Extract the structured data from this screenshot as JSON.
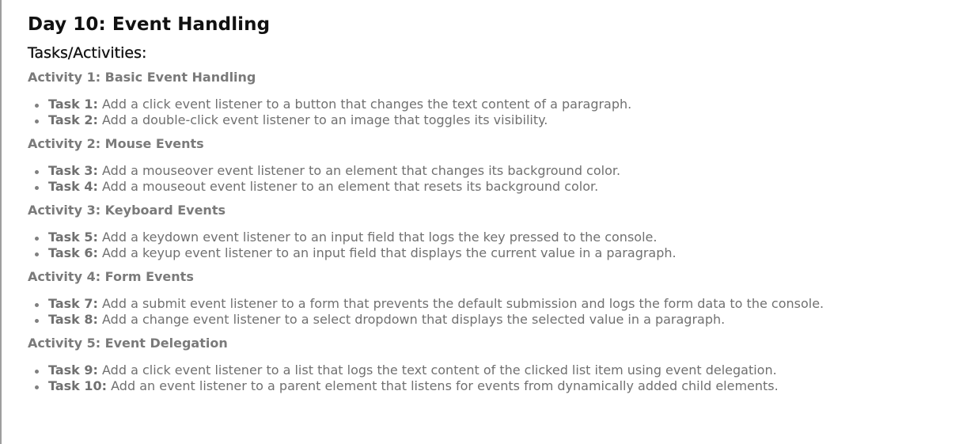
{
  "title": "Day 10: Event Handling",
  "subtitle": "Tasks/Activities:",
  "activities": [
    {
      "heading": "Activity 1: Basic Event Handling",
      "tasks": [
        {
          "label": "Task 1:",
          "text": " Add a click event listener to a button that changes the text content of a paragraph."
        },
        {
          "label": "Task 2:",
          "text": " Add a double-click event listener to an image that toggles its visibility."
        }
      ]
    },
    {
      "heading": "Activity 2: Mouse Events",
      "tasks": [
        {
          "label": "Task 3:",
          "text": " Add a mouseover event listener to an element that changes its background color."
        },
        {
          "label": "Task 4:",
          "text": " Add a mouseout event listener to an element that resets its background color."
        }
      ]
    },
    {
      "heading": "Activity 3: Keyboard Events",
      "tasks": [
        {
          "label": "Task 5:",
          "text": " Add a keydown event listener to an input field that logs the key pressed to the console."
        },
        {
          "label": "Task 6:",
          "text": " Add a keyup event listener to an input field that displays the current value in a paragraph."
        }
      ]
    },
    {
      "heading": "Activity 4: Form Events",
      "tasks": [
        {
          "label": "Task 7:",
          "text": " Add a submit event listener to a form that prevents the default submission and logs the form data to the console."
        },
        {
          "label": "Task 8:",
          "text": " Add a change event listener to a select dropdown that displays the selected value in a paragraph."
        }
      ]
    },
    {
      "heading": "Activity 5: Event Delegation",
      "tasks": [
        {
          "label": "Task 9:",
          "text": " Add a click event listener to a list that logs the text content of the clicked list item using event delegation."
        },
        {
          "label": "Task 10:",
          "text": " Add an event listener to a parent element that listens for events from dynamically added child elements."
        }
      ]
    }
  ]
}
